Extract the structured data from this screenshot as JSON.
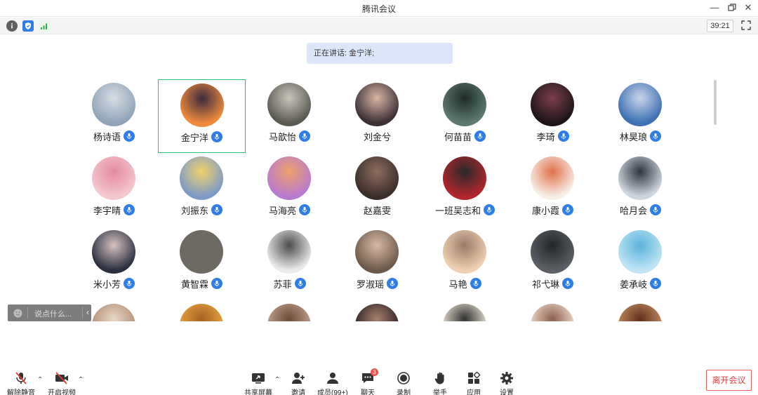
{
  "window": {
    "title": "腾讯会议"
  },
  "status": {
    "timer": "39:21"
  },
  "speaking": {
    "label": "正在讲话:",
    "name": "金宁洋;"
  },
  "participants": [
    {
      "name": "杨诗语",
      "mic": true
    },
    {
      "name": "金宁洋",
      "mic": true,
      "active": true
    },
    {
      "name": "马歆怡",
      "mic": true
    },
    {
      "name": "刘金兮",
      "mic": false
    },
    {
      "name": "何苗苗",
      "mic": true
    },
    {
      "name": "李琦",
      "mic": true
    },
    {
      "name": "林昊琅",
      "mic": true
    },
    {
      "name": "李宇晴",
      "mic": true
    },
    {
      "name": "刘振东",
      "mic": true
    },
    {
      "name": "马海亮",
      "mic": true
    },
    {
      "name": "赵嘉雯",
      "mic": false
    },
    {
      "name": "一班吴志和",
      "mic": true
    },
    {
      "name": "康小霞",
      "mic": true
    },
    {
      "name": "哈月会",
      "mic": true
    },
    {
      "name": "米小芳",
      "mic": true
    },
    {
      "name": "黄智霖",
      "mic": true
    },
    {
      "name": "苏菲",
      "mic": true
    },
    {
      "name": "罗淑瑶",
      "mic": true
    },
    {
      "name": "马艳",
      "mic": true
    },
    {
      "name": "祁弋琳",
      "mic": true
    },
    {
      "name": "姜承岐",
      "mic": true
    }
  ],
  "chat": {
    "placeholder": "说点什么..."
  },
  "toolbar": {
    "unmute": "解除静音",
    "start_video": "开启视频",
    "share": "共享屏幕",
    "invite": "邀请",
    "members": "成员(99+)",
    "chat": "聊天",
    "chat_badge": "3",
    "record": "录制",
    "raise_hand": "举手",
    "apps": "应用",
    "settings": "设置",
    "leave": "离开会议"
  },
  "colors": {
    "accent": "#2f7ee8",
    "active_border": "#2fbe72",
    "leave": "#e04343"
  }
}
